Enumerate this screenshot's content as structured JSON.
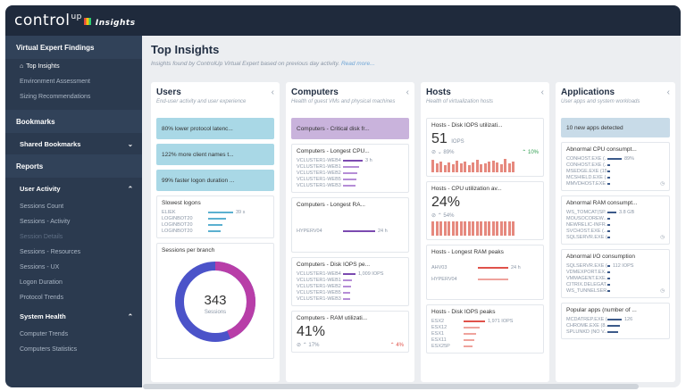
{
  "app": {
    "logo": "control",
    "logo_sup": "up",
    "logo_suffix": "Insights"
  },
  "sidebar": {
    "section1": "Virtual Expert Findings",
    "items1": [
      "Top Insights",
      "Environment Assessment",
      "Sizing Recommendations"
    ],
    "bookmarks": "Bookmarks",
    "shared_bookmarks": "Shared Bookmarks",
    "reports": "Reports",
    "user_activity": "User Activity",
    "items2": [
      "Sessions Count",
      "Sessions - Activity",
      "Session Details",
      "Sessions - Resources",
      "Sessions - UX",
      "Logon Duration",
      "Protocol Trends"
    ],
    "system_health": "System Health",
    "items3": [
      "Computer Trends",
      "Computers Statistics"
    ]
  },
  "main": {
    "title": "Top Insights",
    "subtitle": "Insights found by ControlUp Virtual Expert based on previous day activity.",
    "read_more": "Read more..."
  },
  "columns": {
    "users": {
      "title": "Users",
      "desc": "End-user activity and user experience",
      "cards": [
        "80% lower protocol latenc...",
        "122% more client names t...",
        "99% faster logon duration ..."
      ],
      "slow_logons": {
        "title": "Slowest logons",
        "rows": [
          "ELIEK",
          "LOGINBOT20",
          "LOGINBOT20",
          "LOGINBOT20"
        ],
        "value": "39 s"
      },
      "sessions": {
        "title": "Sessions per branch",
        "count": "343",
        "label": "Sessions"
      }
    },
    "computers": {
      "title": "Computers",
      "desc": "Health of guest VMs and physical machines",
      "alert": "Computers - Critical disk fr...",
      "cpu": {
        "title": "Computers - Longest CPU...",
        "rows": [
          "VCLUSTER1-WEB4",
          "VCLUSTER1-WEB1",
          "VCLUSTER1-WEB2",
          "VCLUSTER1-WEB5",
          "VCLUSTER1-WEB3"
        ],
        "value": "3 h"
      },
      "ram": {
        "title": "Computers - Longest RA...",
        "row": "HYPERV04",
        "value": "24 h"
      },
      "iops": {
        "title": "Computers - Disk IOPS pe...",
        "rows": [
          "VCLUSTER1-WEB4",
          "VCLUSTER1-WEB1",
          "VCLUSTER1-WEB2",
          "VCLUSTER1-WEB5",
          "VCLUSTER1-WEB3"
        ],
        "value": "1,009 IOPS"
      },
      "ramutil": {
        "title": "Computers - RAM utilizati...",
        "big": "41%",
        "trend_left": "17%",
        "trend_right": "4%"
      }
    },
    "hosts": {
      "title": "Hosts",
      "desc": "Health of virtualization hosts",
      "disk": {
        "title": "Hosts - Disk IOPS utilizati...",
        "big": "51",
        "unit": "IOPS",
        "trend_left": "89%",
        "trend_right": "10%"
      },
      "cpu": {
        "title": "Hosts - CPU utilization av...",
        "big": "24%",
        "trend_left": "54%"
      },
      "ram": {
        "title": "Hosts - Longest RAM peaks",
        "rows": [
          "AHV03",
          "HYPERV04"
        ],
        "value": "24 h"
      },
      "iops": {
        "title": "Hosts - Disk IOPS peaks",
        "rows": [
          "ESX2",
          "ESX12",
          "ESX1",
          "ESX11",
          "ESX25P"
        ],
        "value": "1,971 IOPS"
      }
    },
    "apps": {
      "title": "Applications",
      "desc": "User apps and system workloads",
      "alert": "10 new apps detected",
      "cpu": {
        "title": "Abnormal CPU consumpt...",
        "rows": [
          "CONHOST.EXE (...",
          "CONHOST.EXE (...",
          "MSEDGE.EXE (15.0...",
          "MCSHIELD.EXE (...",
          "MMVDHOST.EXE (..."
        ],
        "value": "89%"
      },
      "ram": {
        "title": "Abnormal RAM consumpt...",
        "rows": [
          "WS_TOMCAT(SP...",
          "MOUSOCOREW...",
          "NEWRELIC-INFR...",
          "SVCHOST.EXE (...",
          "SQLSERVR.EXE (..."
        ],
        "value": "3.8 GB"
      },
      "io": {
        "title": "Abnormal I/O consumption",
        "rows": [
          "SQLSERVR.EXE (...",
          "VDMEXPORT.EX...",
          "VMMAGENT.EXE...",
          "CITRIX.DELEGAT...",
          "WS_TUNNELSER..."
        ],
        "value": "112 IOPS"
      },
      "popular": {
        "title": "Popular apps (number of ...",
        "rows": [
          "MCDATREP.EXE (...",
          "CHROME.EXE (8...",
          "SPLUNKD (NO V..."
        ],
        "value": "126"
      }
    }
  }
}
